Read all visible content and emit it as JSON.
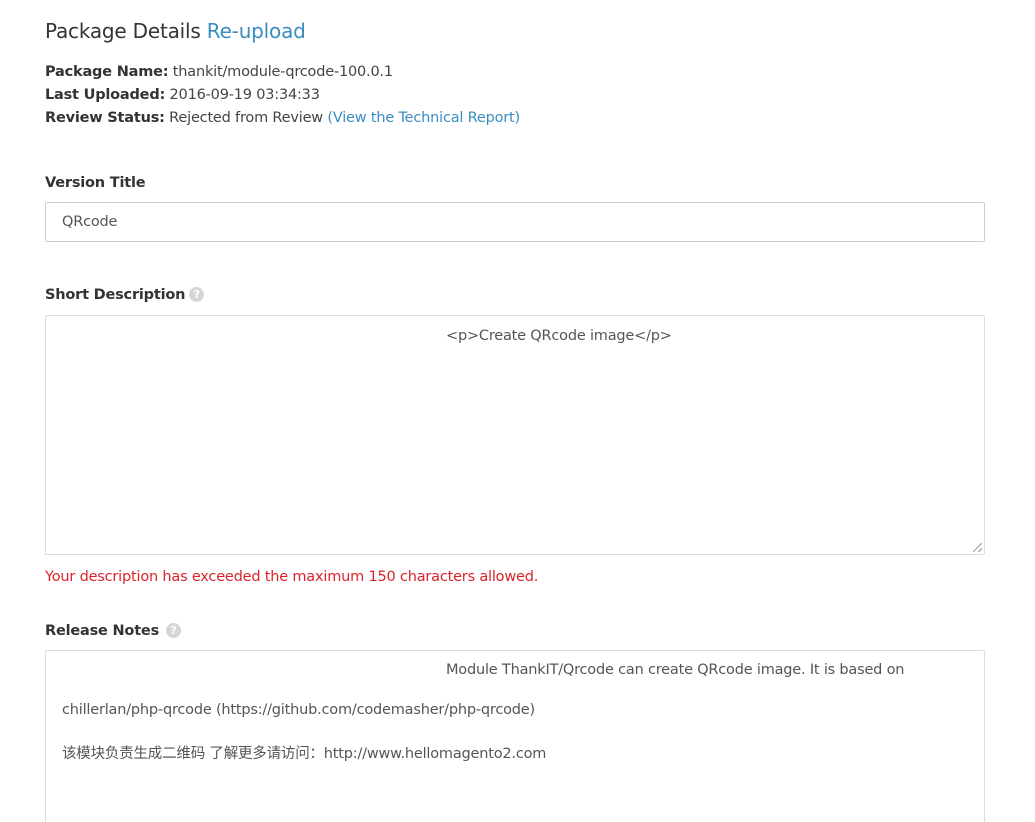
{
  "header": {
    "title": "Package Details",
    "reupload_label": "Re-upload"
  },
  "package": {
    "name_label": "Package Name:",
    "name_value": "thankit/module-qrcode-100.0.1",
    "uploaded_label": "Last Uploaded:",
    "uploaded_value": "2016-09-19 03:34:33",
    "status_label": "Review Status:",
    "status_value": "Rejected from Review",
    "report_link": "(View the Technical Report)"
  },
  "version_title": {
    "label": "Version Title",
    "value": "QRcode"
  },
  "short_description": {
    "label": "Short Description",
    "help_icon": "question-circle-icon",
    "value": "<p>Create QRcode image</p>",
    "error": "Your description has exceeded the maximum 150 characters allowed."
  },
  "release_notes": {
    "label": "Release Notes",
    "help_icon": "question-circle-icon",
    "lines": [
      "Module ThankIT/Qrcode can create QRcode image. It is based on",
      "chillerlan/php-qrcode (https://github.com/codemasher/php-qrcode)",
      "该模块负责生成二维码 了解更多请访问：http://www.hellomagento2.com"
    ]
  },
  "colors": {
    "link": "#3b8dc1",
    "error": "#d9232b",
    "text": "#333333"
  }
}
